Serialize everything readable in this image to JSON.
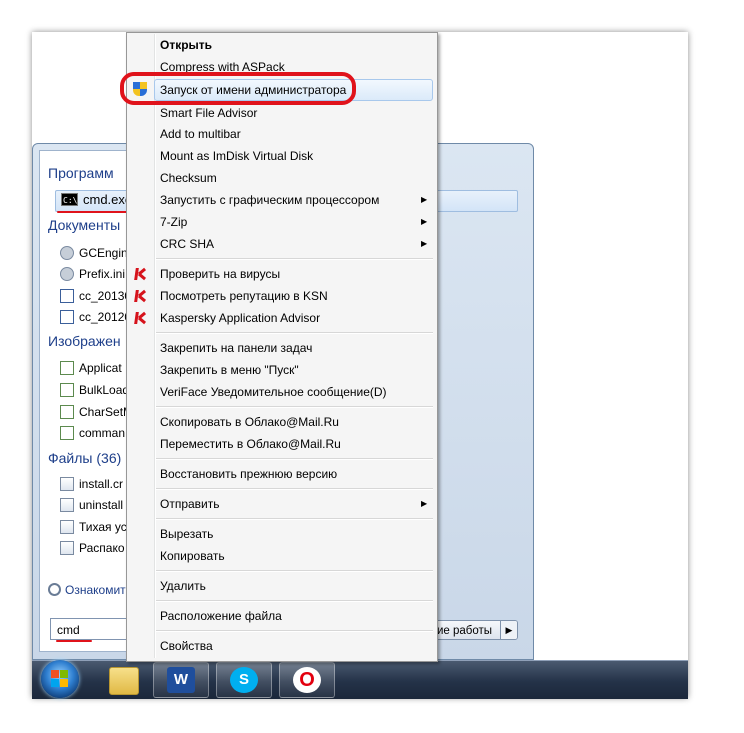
{
  "start_menu": {
    "programs_header": "Программ",
    "cmd_label": "cmd.exe",
    "cmd_icon_text": "C:\\",
    "documents_header": "Документы",
    "documents": [
      "GCEngin",
      "Prefix.ini",
      "cc_20130",
      "cc_20120"
    ],
    "images_header": "Изображен",
    "images": [
      "Applicat",
      "BulkLoad",
      "CharSetM",
      "comman"
    ],
    "files_header": "Файлы (36)",
    "files": [
      "install.cr",
      "uninstall",
      "Тихая ус",
      "Распако"
    ],
    "see_more": "Ознакомит",
    "search_value": "cmd",
    "shutdown_label": "ие работы",
    "shutdown_arrow": "▶"
  },
  "context_menu": {
    "items_group1": [
      {
        "label": "Открыть",
        "bold": true
      },
      {
        "label": "Compress with ASPack"
      },
      {
        "label": "Запуск от имени администратора",
        "highlighted": true,
        "icon": "uac-shield-icon"
      },
      {
        "label": "Smart File Advisor"
      },
      {
        "label": "Add to multibar"
      },
      {
        "label": "Mount as ImDisk Virtual Disk"
      },
      {
        "label": "Checksum"
      },
      {
        "label": "Запустить с графическим процессором",
        "submenu": true
      },
      {
        "label": "7-Zip",
        "submenu": true
      },
      {
        "label": "CRC SHA",
        "submenu": true
      }
    ],
    "items_group2": [
      {
        "label": "Проверить на вирусы",
        "icon": "kaspersky-icon"
      },
      {
        "label": "Посмотреть репутацию в KSN",
        "icon": "kaspersky-icon"
      },
      {
        "label": "Kaspersky Application Advisor",
        "icon": "kaspersky-icon"
      }
    ],
    "items_group3": [
      "Закрепить на панели задач",
      "Закрепить в меню \"Пуск\"",
      "VeriFace Уведомительное сообщение(D)"
    ],
    "items_group4": [
      "Скопировать в Облако@Mail.Ru",
      "Переместить в Облако@Mail.Ru"
    ],
    "items_group5": [
      "Восстановить прежнюю версию"
    ],
    "items_group6": [
      "Отправить"
    ],
    "items_group7": [
      "Вырезать",
      "Копировать"
    ],
    "items_group8": [
      "Удалить"
    ],
    "items_group9": [
      "Расположение файла"
    ],
    "items_group10": [
      "Свойства"
    ],
    "submenu_arrow": "▶"
  },
  "taskbar": {
    "apps": [
      "start-orb",
      "explorer",
      "word",
      "skype",
      "opera"
    ],
    "word_glyph": "W",
    "skype_glyph": "S",
    "opera_glyph": "O"
  },
  "colors": {
    "annotation_red": "#e0131b",
    "kaspersky_red": "#d6121b",
    "highlight": "#dbeaf9"
  }
}
